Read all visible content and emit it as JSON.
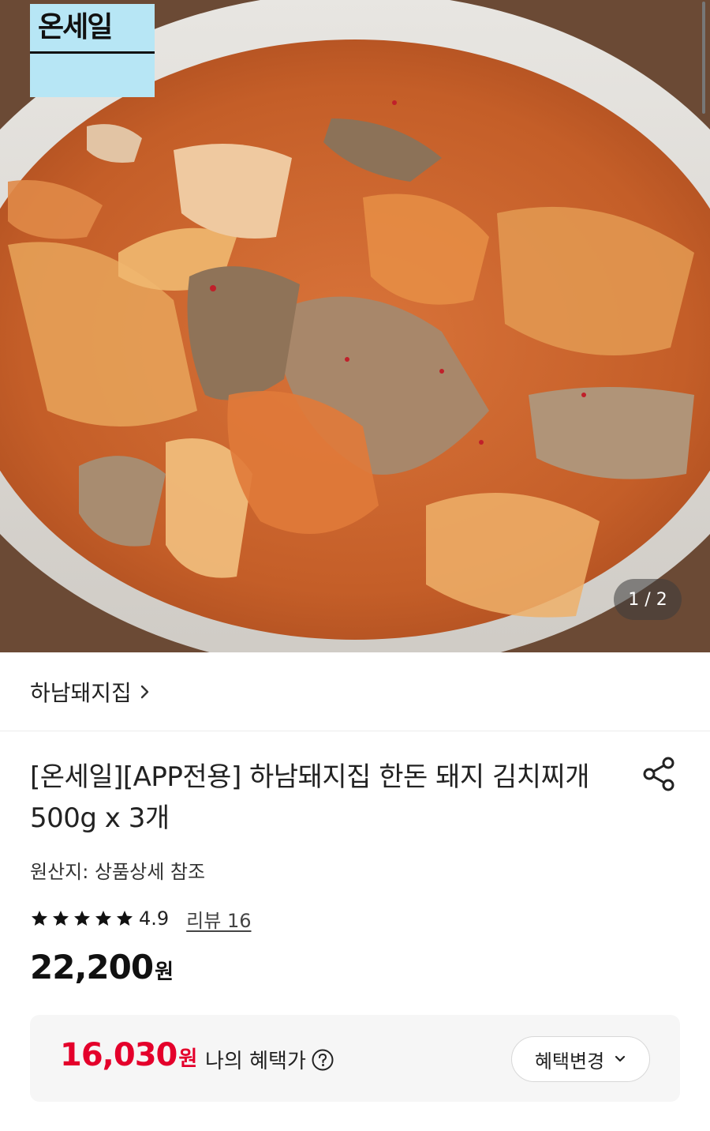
{
  "hero": {
    "badge_text": "온세일",
    "page_counter": "1 / 2"
  },
  "brand": {
    "name": "하남돼지집"
  },
  "product": {
    "title": "[온세일][APP전용] 하남돼지집 한돈 돼지 김치찌개 500g x 3개",
    "origin": "원산지: 상품상세 참조",
    "rating": "4.9",
    "stars": 5,
    "review_link": "리뷰 16",
    "price": "22,200",
    "price_unit": "원"
  },
  "benefit": {
    "price": "16,030",
    "price_unit": "원",
    "label": "나의 혜택가",
    "change_button": "혜택변경"
  },
  "colors": {
    "accent_red": "#e4002b",
    "badge_bg": "#b7e6f5"
  },
  "icons": [
    "chevron-right-icon",
    "share-icon",
    "star-icon",
    "help-circle-icon",
    "chevron-down-icon"
  ]
}
